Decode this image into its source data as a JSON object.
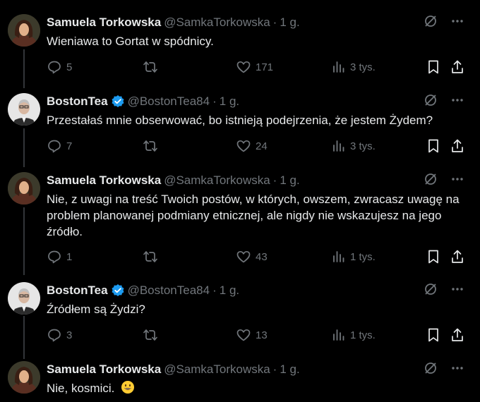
{
  "tweets": [
    {
      "author": "Samuela Torkowska",
      "handle": "@SamkaTorkowska",
      "time": "1 g.",
      "verified": false,
      "text": "Wieniawa to Gortat w spódnicy.",
      "replies": "5",
      "retweets": "",
      "likes": "171",
      "views": "3 tys."
    },
    {
      "author": "BostonTea",
      "handle": "@BostonTea84",
      "time": "1 g.",
      "verified": true,
      "text": "Przestałaś mnie obserwować, bo istnieją podejrzenia, że jestem Żydem?",
      "replies": "7",
      "retweets": "",
      "likes": "24",
      "views": "3 tys."
    },
    {
      "author": "Samuela Torkowska",
      "handle": "@SamkaTorkowska",
      "time": "1 g.",
      "verified": false,
      "text": "Nie, z uwagi na treść Twoich postów, w których, owszem, zwracasz uwagę na problem planowanej podmiany etnicznej, ale nigdy nie wskazujesz na jego źródło.",
      "replies": "1",
      "retweets": "",
      "likes": "43",
      "views": "1 tys."
    },
    {
      "author": "BostonTea",
      "handle": "@BostonTea84",
      "time": "1 g.",
      "verified": true,
      "text": "Źródłem są Żydzi?",
      "replies": "3",
      "retweets": "",
      "likes": "13",
      "views": "1 tys."
    },
    {
      "author": "Samuela Torkowska",
      "handle": "@SamkaTorkowska",
      "time": "1 g.",
      "verified": false,
      "text": "Nie, kosmici.",
      "emoji": "grinning-face-emoji"
    }
  ],
  "colors": {
    "background": "#000000",
    "text": "#e7e9ea",
    "muted": "#71767b",
    "verified": "#1d9bf0",
    "thread_line": "#333639"
  },
  "icons": [
    "reply-icon",
    "retweet-icon",
    "like-icon",
    "views-icon",
    "bookmark-icon",
    "share-icon",
    "grok-icon",
    "more-icon",
    "verified-badge-icon"
  ]
}
